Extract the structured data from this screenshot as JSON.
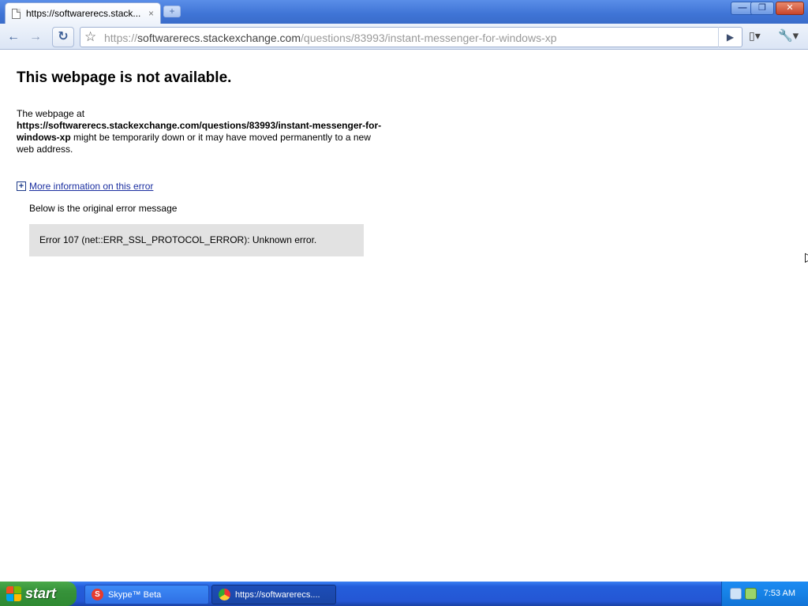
{
  "browser": {
    "tab": {
      "title": "https://softwarerecs.stack...",
      "close": "×"
    },
    "new_tab": "+",
    "window_controls": {
      "minimize": "—",
      "restore": "❐",
      "close": "✕"
    },
    "toolbar": {
      "back": "←",
      "forward": "→",
      "reload": "↻",
      "bookmark_star": "☆",
      "url_scheme": "https://",
      "url_domain": "softwarerecs.stackexchange.com",
      "url_path": "/questions/83993/instant-messenger-for-windows-xp",
      "go": "▶",
      "page_menu": "▯▾",
      "wrench_menu": "🔧▾"
    }
  },
  "page": {
    "title": "This webpage is not available.",
    "desc_prefix": "The webpage at",
    "desc_url": "https://softwarerecs.stackexchange.com/questions/83993/instant-messenger-for-windows-xp",
    "desc_suffix": "might be temporarily down or it may have moved permanently to a new web address.",
    "more_info_toggle": "+",
    "more_info_link": "More information on this error",
    "below_message": "Below is the original error message",
    "error_message": "Error 107 (net::ERR_SSL_PROTOCOL_ERROR): Unknown error."
  },
  "taskbar": {
    "start_label": "start",
    "tasks": [
      {
        "label": "Skype™ Beta",
        "icon": "skype-icon"
      },
      {
        "label": "https://softwarerecs....",
        "icon": "chrome-icon"
      }
    ],
    "clock": "7:53 AM"
  }
}
